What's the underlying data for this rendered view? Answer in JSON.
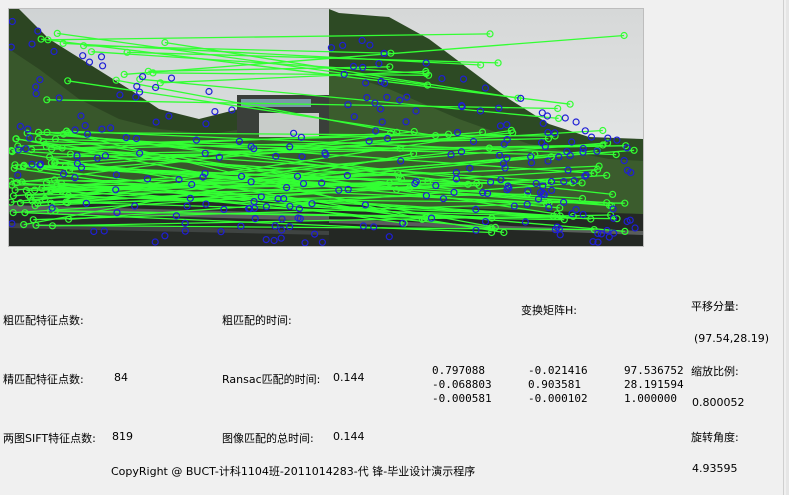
{
  "window": {
    "match_image_caption": ""
  },
  "labels": {
    "coarse_match_count": "粗匹配特征点数:",
    "coarse_match_time": "粗匹配的时间:",
    "transform_matrix": "变换矩阵H:",
    "translation": "平移分量:",
    "fine_match_count": "精匹配特征点数:",
    "ransac_time": "Ransac匹配的时间:",
    "scale_ratio": "缩放比例:",
    "sift_points": "两图SIFT特征点数:",
    "total_time": "图像匹配的总时间:",
    "rotation_angle": "旋转角度:"
  },
  "values": {
    "coarse_match_count": "",
    "coarse_match_time": "",
    "translation": "(97.54,28.19)",
    "fine_match_count": "84",
    "ransac_time": "0.144",
    "scale_ratio": "0.800052",
    "sift_points": "819",
    "total_time": "0.144",
    "rotation_angle": "4.93595"
  },
  "matrix": {
    "rows": [
      [
        "0.797088",
        "-0.021416",
        "97.536752"
      ],
      [
        "-0.068803",
        "0.903581",
        "28.191594"
      ],
      [
        "-0.000581",
        "-0.000102",
        "1.000000"
      ]
    ]
  },
  "footer": {
    "copyright": "CopyRight @ BUCT-计科1104班-2011014283-代 锋-毕业设计演示程序"
  },
  "colors": {
    "match_line": "#33ff33",
    "keypoint": "#1f1fd6",
    "sky": "#d9dcdd",
    "hill": "#2f4a24"
  }
}
